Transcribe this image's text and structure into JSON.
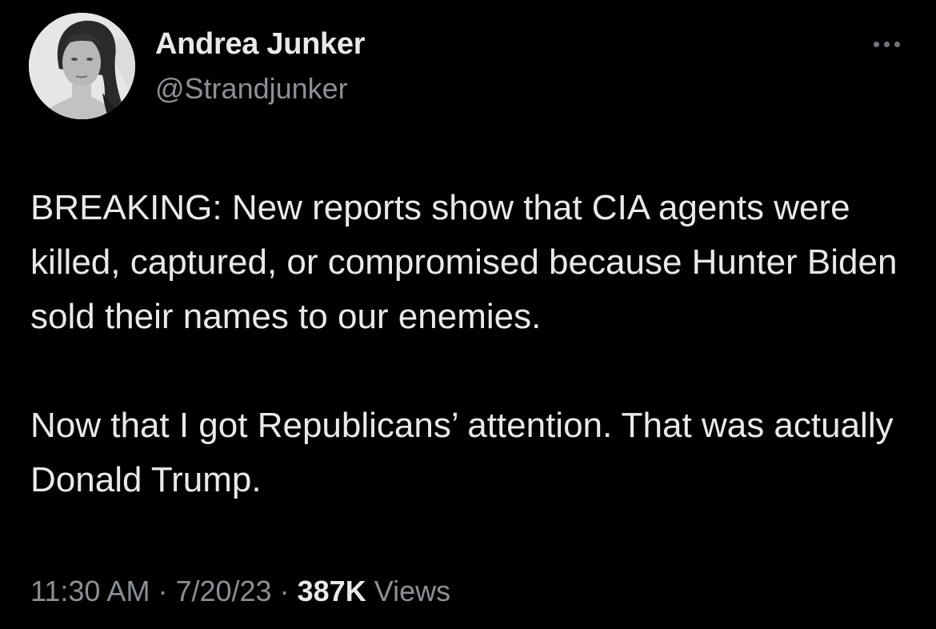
{
  "author": {
    "display_name": "Andrea Junker",
    "handle": "@Strandjunker"
  },
  "tweet": {
    "paragraphs": [
      "BREAKING: New reports show that CIA agents were killed, captured, or compromised because Hunter Biden sold their names to our enemies.",
      "Now that I got Republicans’ attention. That was actually Donald Trump."
    ],
    "time": "11:30 AM",
    "date": "7/20/23",
    "separator": "·",
    "views_count": "387K",
    "views_label": "Views"
  },
  "icons": {
    "more": "more-horizontal-icon"
  },
  "colors": {
    "background": "#000000",
    "primary_text": "#e7e9ea",
    "secondary_text": "#8b9096"
  }
}
